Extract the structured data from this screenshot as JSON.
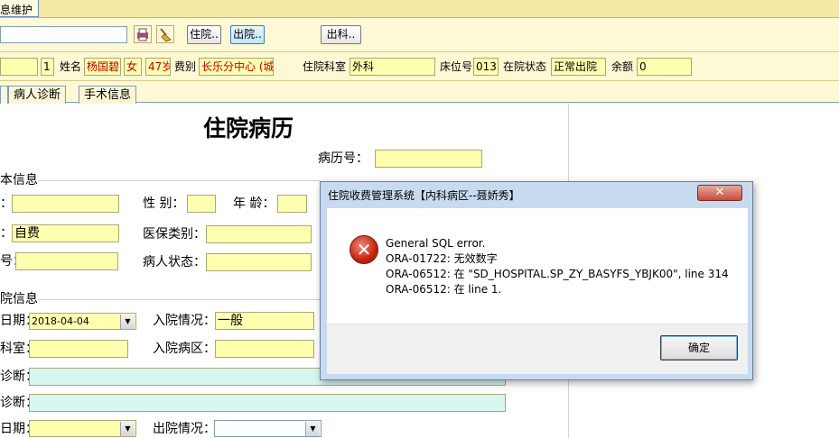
{
  "window": {
    "title_tab": "息维护"
  },
  "toolbar": {
    "admit_label": "住院..",
    "discharge_label": "出院..",
    "dept_out_label": "出科.."
  },
  "patient_bar": {
    "seq_value": "1",
    "name_label": "姓名",
    "name_value": "杨国碧",
    "sex_value": "女",
    "age_value": "47岁",
    "fee_label": "费别",
    "fee_value": "长乐分中心 (城",
    "dept_label": "住院科室",
    "dept_value": "外科",
    "bed_label": "床位号",
    "bed_value": "013",
    "status_label": "在院状态",
    "status_value": "正常出院",
    "balance_label": "余额",
    "balance_value": "0"
  },
  "tabs": [
    {
      "label": "病人诊断"
    },
    {
      "label": "手术信息"
    }
  ],
  "form": {
    "title": "住院病历",
    "record_no_label": "病历号：",
    "basic_section": "本信息",
    "colon1": "：",
    "sex_label": "性  别：",
    "age_label": "年  龄：",
    "colon2": "：",
    "fee_value": "自费",
    "insurance_label": "医保类别：",
    "id_suffix": "号：",
    "patient_status_label": "病人状态：",
    "admit_section": "院信息",
    "date_label": "日期：",
    "date_value": "2018-04-04",
    "admit_situation_label": "入院情况：",
    "admit_situation_value": "一般",
    "dept_label": "科室：",
    "admit_ward_label": "入院病区：",
    "diag1_label": "诊断：",
    "diag2_label": "诊断：",
    "out_date_label": "日期：",
    "out_situation_label": "出院情况："
  },
  "dialog": {
    "title": "住院收费管理系统【内科病区--聂娇秀】",
    "close_glyph": "✕",
    "lines": [
      "General SQL error.",
      "ORA-01722: 无效数字",
      "ORA-06512: 在 \"SD_HOSPITAL.SP_ZY_BASYFS_YBJK00\", line 314",
      "ORA-06512: 在 line 1."
    ],
    "ok_label": "确定"
  },
  "colors": {
    "field_yellow": "#ffffb0",
    "field_cyan": "#d7f7f0",
    "error_red": "#c6230f",
    "text_red": "#c00000"
  }
}
